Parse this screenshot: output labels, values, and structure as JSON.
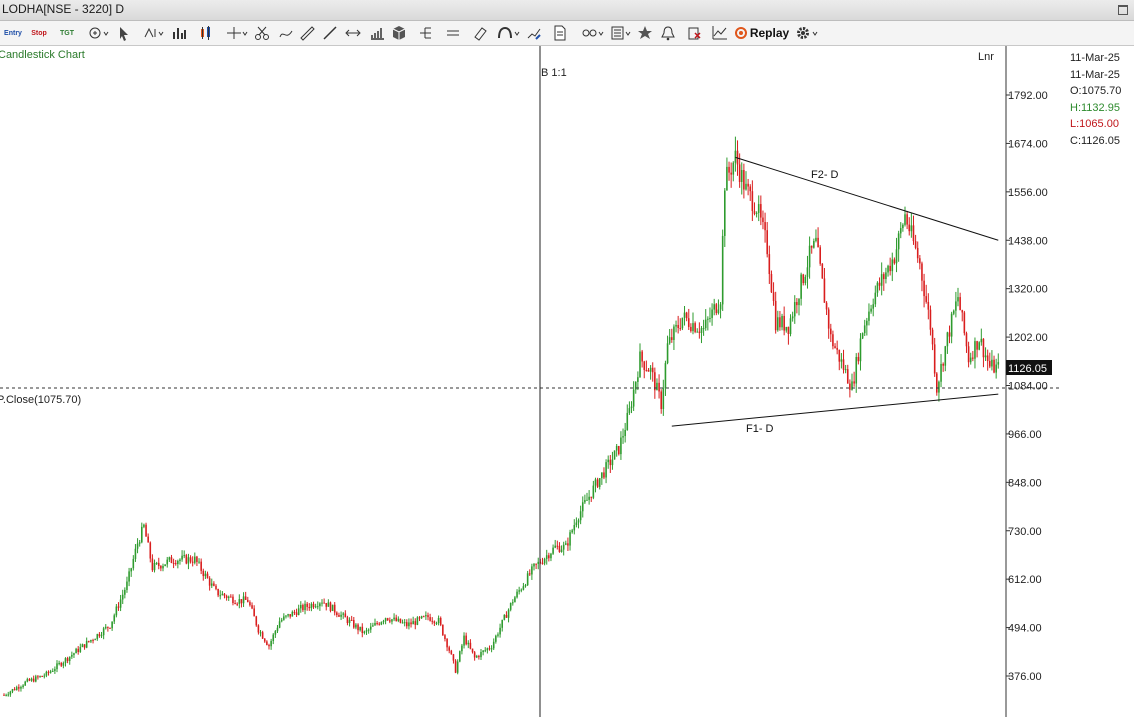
{
  "window": {
    "title": "LODHA[NSE - 3220] D"
  },
  "toolbar": {
    "entry_label": "Entry",
    "stop_label": "Stop",
    "tgt_label": "TGT",
    "replay_label": "Replay",
    "period_label": "D",
    "colors": {
      "entry": "#1f4fa8",
      "stop": "#c0161b",
      "tgt": "#2e7d32",
      "replay_icon": "#e0561b"
    },
    "icons": [
      "bull-bear-icon",
      "pointer-icon",
      "line-style-icon",
      "bar-chart-icon",
      "candlestick-icon",
      "crosshair-icon",
      "scissors-icon",
      "curve-icon",
      "ruler-icon",
      "trendline-icon",
      "horizontal-arrow-icon",
      "volume-icon",
      "cube-icon",
      "fork-icon",
      "parallel-lines-icon",
      "eraser-icon",
      "magnet-icon",
      "hand-icon",
      "edit-chart-icon",
      "paper-icon",
      "link-icon",
      "template-icon",
      "star-icon",
      "alert-icon",
      "delete-icon",
      "indicator-icon",
      "replay-icon",
      "gear-icon"
    ]
  },
  "chart": {
    "type_label": "Candlestick Chart",
    "scale_label": "Lnr"
  },
  "crosshair": {
    "label": "B 1:1",
    "prev_close_label": "P.Close(1075.70)",
    "prev_close": 1075.7
  },
  "quote": {
    "date1": "11-Mar-25",
    "date2": "11-Mar-25",
    "open": "O:1075.70",
    "high": "H:1132.95",
    "low": "L:1065.00",
    "close": "C:1126.05"
  },
  "last_price_label": "1126.05",
  "annotations": {
    "f1": "F1- D",
    "f2": "F2- D"
  },
  "chart_data": {
    "type": "candlestick",
    "scale": "linear",
    "ylim": [
      330,
      1850
    ],
    "yticks": [
      1792.0,
      1674.0,
      1556.0,
      1438.0,
      1320.0,
      1202.0,
      1084.0,
      966.0,
      848.0,
      730.0,
      612.0,
      494.0,
      376.0
    ],
    "ytick_labels": [
      "1792.00",
      "1674.00",
      "1556.00",
      "1438.00",
      "1320.00",
      "1202.00",
      "1084.00",
      "966.00",
      "848.00",
      "730.00",
      "612.00",
      "494.00",
      "376.00"
    ],
    "last_price": 1126.05,
    "colors": {
      "up": "#2e9b2e",
      "down": "#d91e1e",
      "line": "#111111"
    },
    "candle_count": 334,
    "trend_path": [
      [
        0,
        330
      ],
      [
        10,
        360
      ],
      [
        20,
        380
      ],
      [
        30,
        420
      ],
      [
        40,
        460
      ],
      [
        50,
        500
      ],
      [
        58,
        600
      ],
      [
        63,
        700
      ],
      [
        66,
        740
      ],
      [
        70,
        640
      ],
      [
        80,
        660
      ],
      [
        90,
        660
      ],
      [
        100,
        580
      ],
      [
        110,
        560
      ],
      [
        115,
        560
      ],
      [
        120,
        490
      ],
      [
        125,
        450
      ],
      [
        130,
        510
      ],
      [
        140,
        540
      ],
      [
        150,
        560
      ],
      [
        160,
        520
      ],
      [
        170,
        480
      ],
      [
        180,
        520
      ],
      [
        190,
        500
      ],
      [
        200,
        520
      ],
      [
        205,
        510
      ],
      [
        210,
        440
      ],
      [
        213,
        390
      ],
      [
        217,
        470
      ],
      [
        222,
        420
      ],
      [
        230,
        450
      ],
      [
        240,
        560
      ],
      [
        250,
        640
      ],
      [
        260,
        690
      ],
      [
        265,
        690
      ],
      [
        270,
        760
      ],
      [
        280,
        850
      ],
      [
        290,
        930
      ],
      [
        295,
        1020
      ],
      [
        300,
        1150
      ],
      [
        305,
        1120
      ],
      [
        310,
        1040
      ],
      [
        313,
        1180
      ],
      [
        320,
        1250
      ],
      [
        330,
        1220
      ],
      [
        338,
        1300
      ],
      [
        340,
        1580
      ],
      [
        345,
        1640
      ],
      [
        350,
        1560
      ],
      [
        355,
        1520
      ],
      [
        360,
        1420
      ],
      [
        364,
        1240
      ],
      [
        370,
        1230
      ],
      [
        380,
        1400
      ],
      [
        383,
        1430
      ],
      [
        390,
        1200
      ],
      [
        400,
        1080
      ],
      [
        405,
        1220
      ],
      [
        410,
        1300
      ],
      [
        420,
        1400
      ],
      [
        425,
        1500
      ],
      [
        432,
        1380
      ],
      [
        437,
        1230
      ],
      [
        440,
        1080
      ],
      [
        445,
        1200
      ],
      [
        450,
        1300
      ],
      [
        455,
        1150
      ],
      [
        460,
        1200
      ],
      [
        465,
        1130
      ],
      [
        469,
        1126
      ]
    ],
    "triangle_top": {
      "from": [
        345,
        1640
      ],
      "to": [
        469,
        1438
      ]
    },
    "triangle_bottom": {
      "from": [
        315,
        985
      ],
      "to": [
        469,
        1063
      ]
    }
  }
}
